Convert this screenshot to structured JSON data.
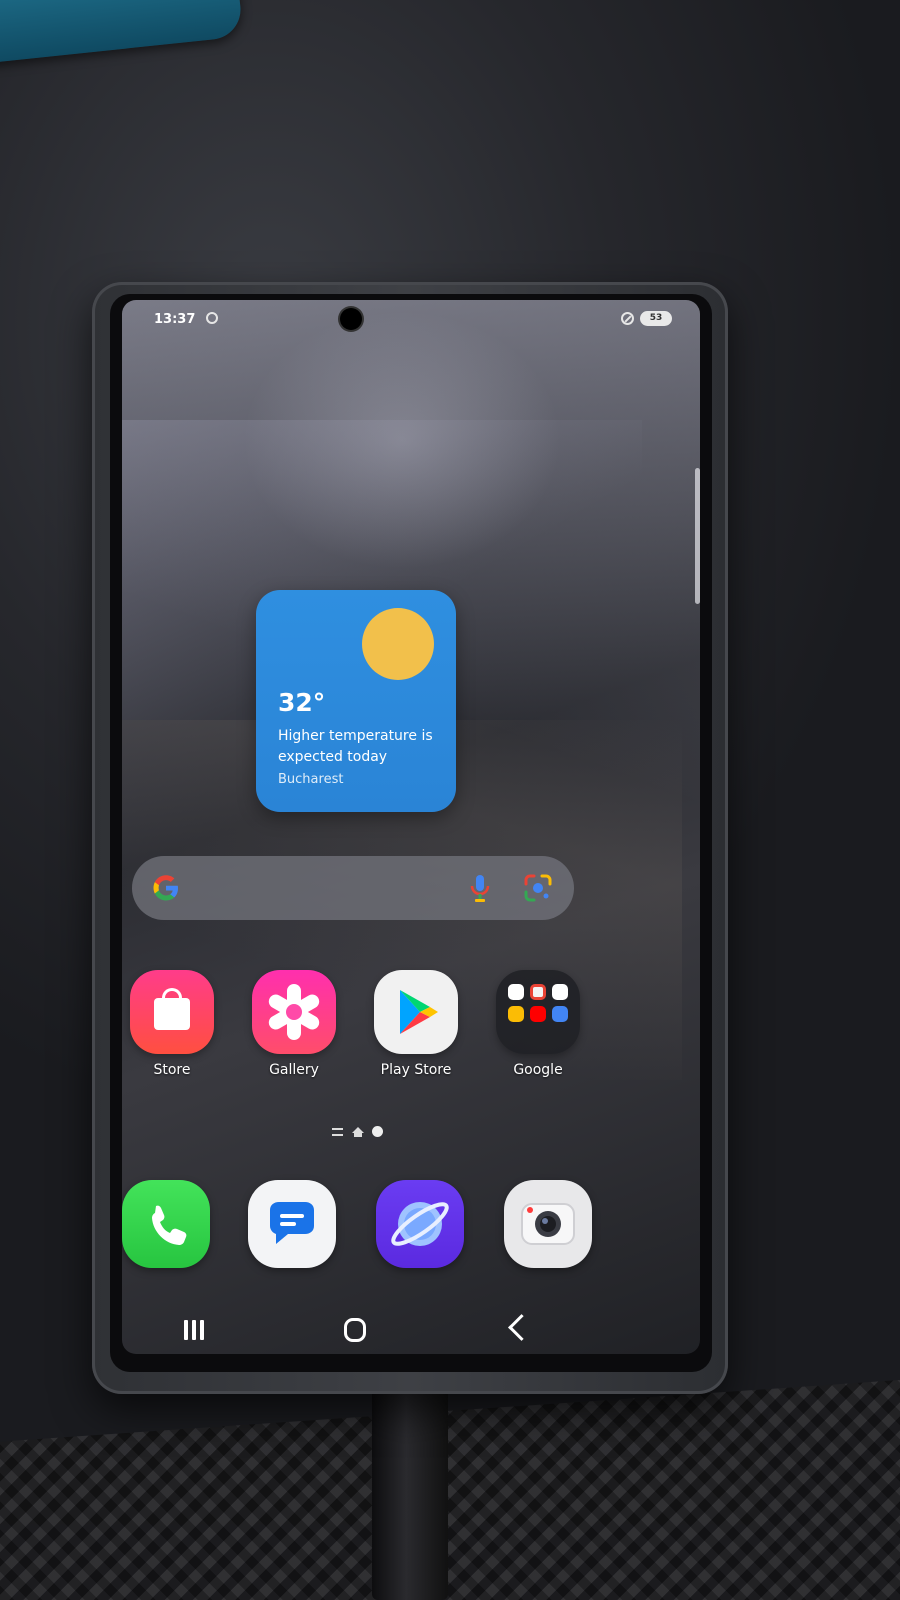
{
  "status_bar": {
    "time": "13:37",
    "battery": "53"
  },
  "weather_widget": {
    "temperature": "32°",
    "description": "Higher temperature is expected today",
    "city": "Bucharest",
    "card_color": "#2f8fe0",
    "sun_color": "#f2c04b"
  },
  "search_bar": {
    "icons": [
      "google-g-icon",
      "microphone-icon",
      "lens-icon"
    ]
  },
  "apps": [
    {
      "label": "Store",
      "icon": "shopping-bag-icon"
    },
    {
      "label": "Gallery",
      "icon": "flower-icon"
    },
    {
      "label": "Play Store",
      "icon": "play-triangle-icon"
    },
    {
      "label": "Google",
      "icon": "google-folder-icon"
    }
  ],
  "dock": [
    {
      "icon": "phone-icon"
    },
    {
      "icon": "messages-icon"
    },
    {
      "icon": "internet-icon"
    },
    {
      "icon": "camera-icon"
    }
  ],
  "navigation": {
    "buttons": [
      "recents-icon",
      "home-icon",
      "back-icon"
    ]
  }
}
